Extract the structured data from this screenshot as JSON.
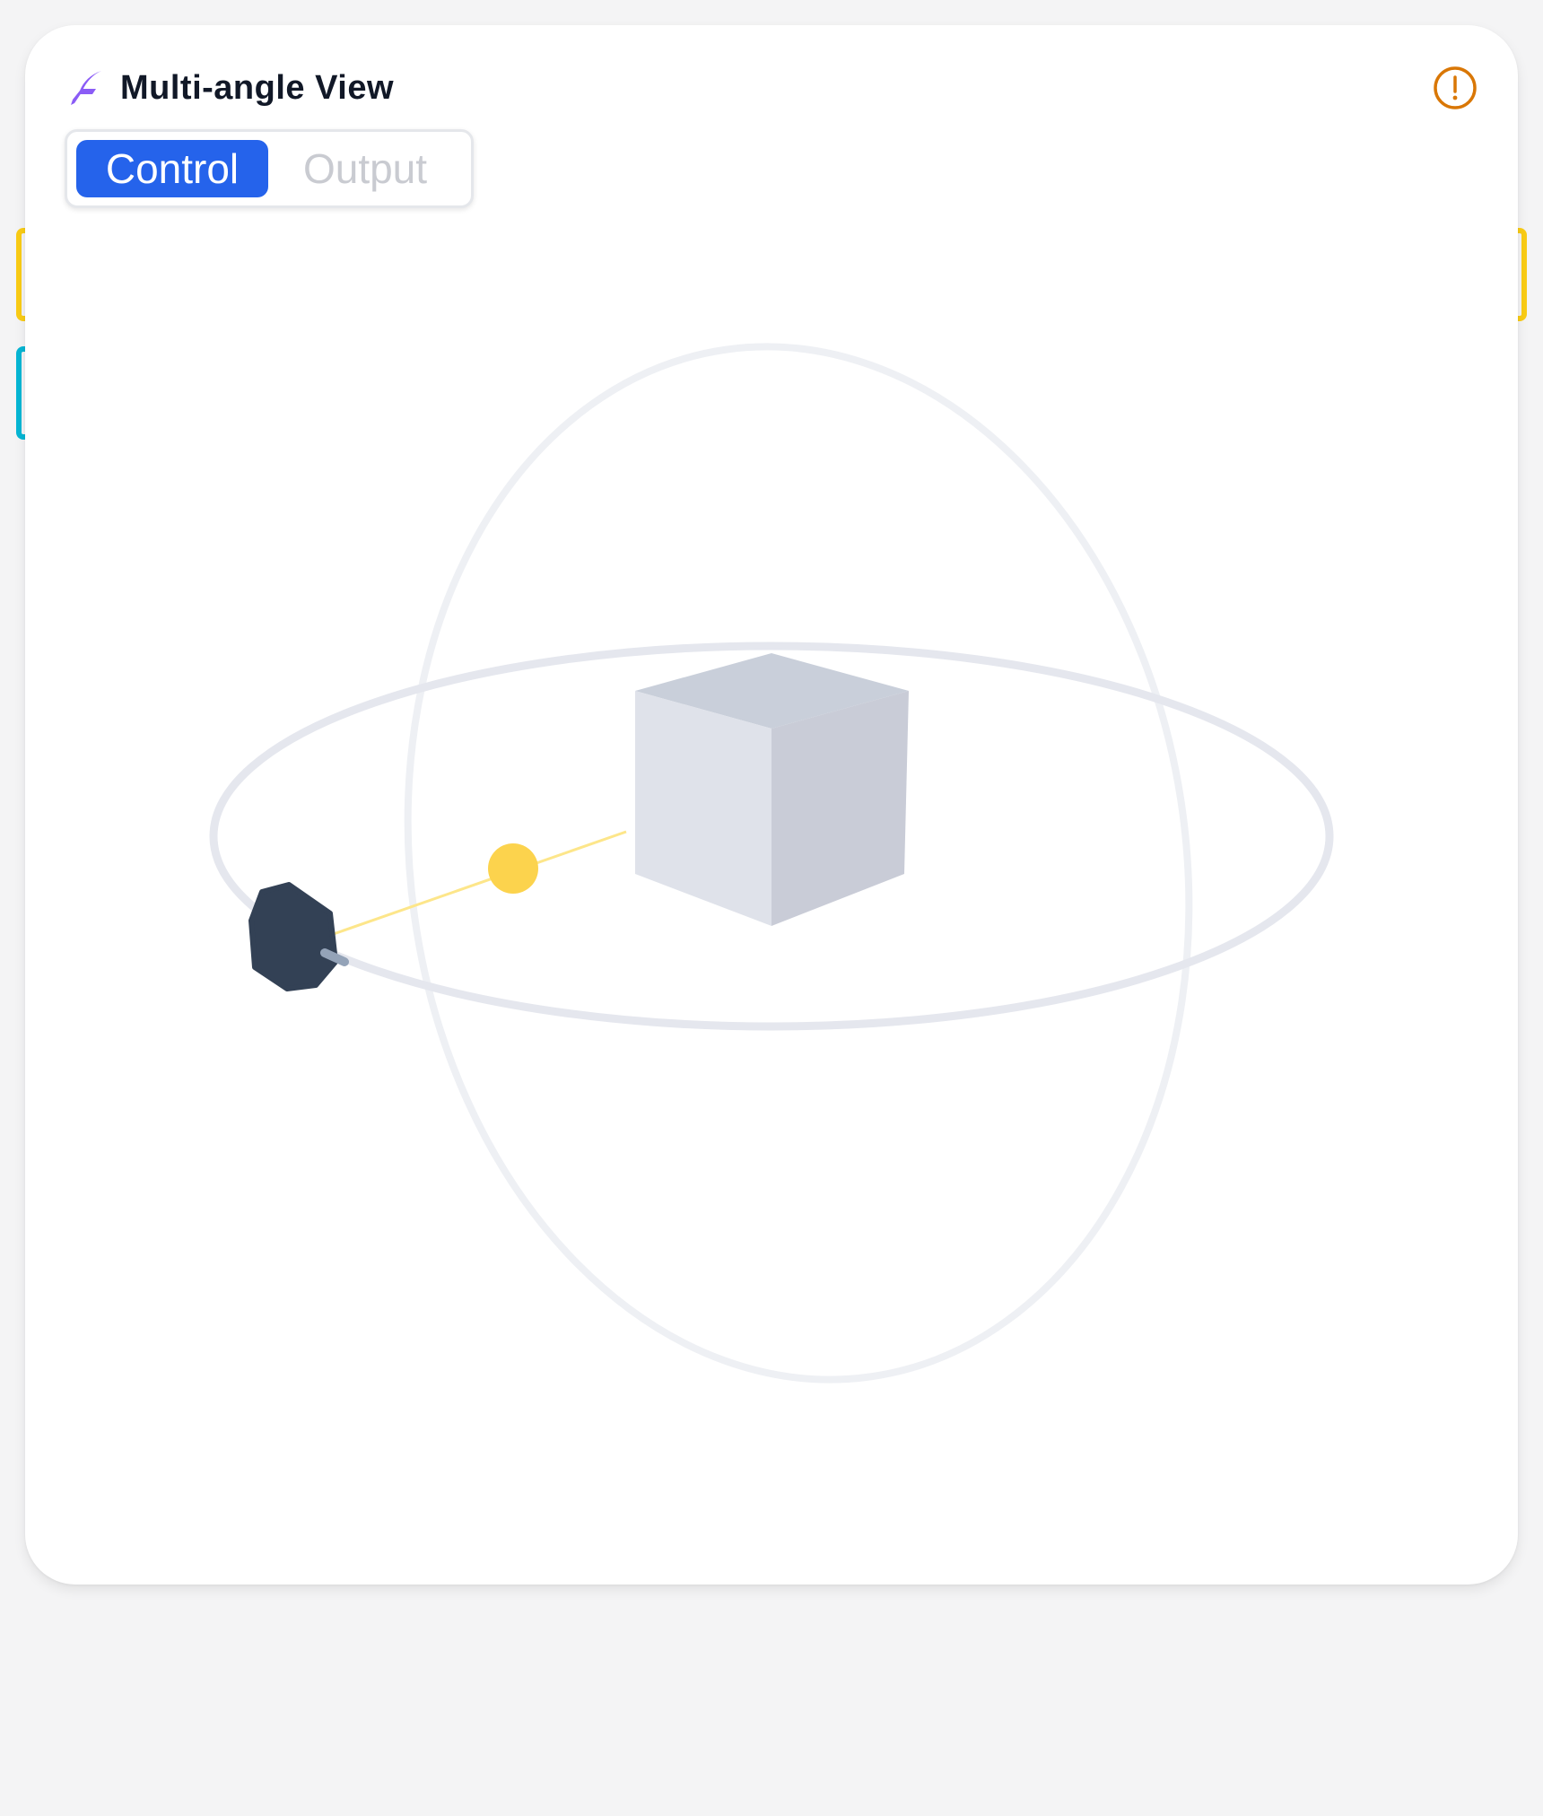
{
  "app": {
    "title": "Multi-angle View",
    "logo_icon": "feather-icon",
    "warning_icon": "alert-circle-icon"
  },
  "tabs": [
    {
      "label": "Control",
      "active": true
    },
    {
      "label": "Output",
      "active": false
    }
  ],
  "colors": {
    "accent": "#2563eb",
    "logo": "#8b5cf6",
    "warning": "#d97706",
    "handle_yellow": "#facc15",
    "handle_cyan": "#06b6d4",
    "camera": "#334155",
    "target": "#fcd34d",
    "orbit": "#e5e7eb"
  }
}
